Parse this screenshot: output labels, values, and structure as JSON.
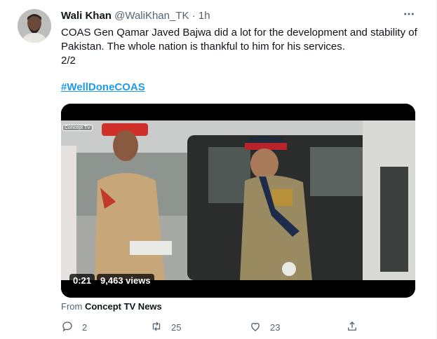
{
  "author": {
    "name": "Wali Khan",
    "handle": "@WaliKhan_TK",
    "separator": "·",
    "time": "1h"
  },
  "tweet": {
    "line1": "COAS Gen Qamar Javed Bajwa did a lot for the development and stability of Pakistan. The whole nation is thankful to him for his services.",
    "line2": "2/2",
    "hashtag": "#WellDoneCOAS"
  },
  "video": {
    "watermark": "Concept TV",
    "duration": "0:21",
    "views": "9,463 views"
  },
  "source": {
    "prefix": "From",
    "name": "Concept TV News"
  },
  "actions": {
    "replies": "2",
    "retweets": "25",
    "likes": "23"
  },
  "icons": {
    "more": "more-icon",
    "reply": "reply-icon",
    "retweet": "retweet-icon",
    "like": "like-icon",
    "share": "share-icon"
  },
  "colors": {
    "link": "#1d9bf0",
    "secondary_text": "#536471",
    "primary_text": "#0f1419"
  }
}
